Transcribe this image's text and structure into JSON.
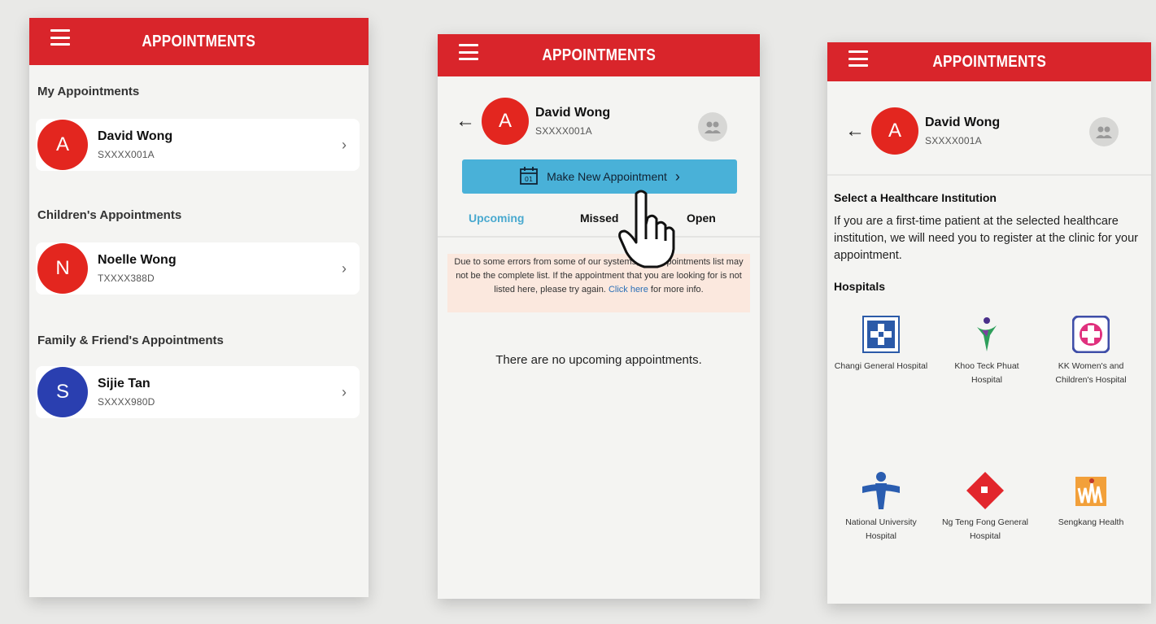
{
  "screen1": {
    "title": "APPOINTMENTS",
    "my_section": "My Appointments",
    "children_section": "Children's Appointments",
    "family_section": "Family & Friend's Appointments",
    "my": {
      "initial": "A",
      "name": "David Wong",
      "id": "SXXXX001A"
    },
    "child": {
      "initial": "N",
      "name": "Noelle Wong",
      "id": "TXXXX388D"
    },
    "family": {
      "initial": "S",
      "name": "Sijie Tan",
      "id": "SXXXX980D"
    }
  },
  "screen2": {
    "title": "APPOINTMENTS",
    "user": {
      "initial": "A",
      "name": "David Wong",
      "id": "SXXXX001A"
    },
    "make_button": "Make New Appointment",
    "tabs": {
      "upcoming": "Upcoming",
      "missed": "Missed",
      "open": "Open"
    },
    "notice_before": "Due to some errors from some of our systems, the Appointments list may not be the complete list. If the appointment that you are looking for is not listed here, please try again.",
    "notice_link": "Click here",
    "notice_after": "for more info.",
    "empty": "There are no upcoming appointments."
  },
  "screen3": {
    "title": "APPOINTMENTS",
    "user": {
      "initial": "A",
      "name": "David Wong",
      "id": "SXXXX001A"
    },
    "institution_title": "Select a Healthcare Institution",
    "institution_desc": "If you are a first-time patient at the selected healthcare institution, we will need you to register at the clinic for your appointment.",
    "hospitals_title": "Hospitals",
    "hospitals": [
      {
        "name": "Changi General Hospital",
        "icon": "changi-general-hospital-logo"
      },
      {
        "name": "Khoo Teck Phuat Hospital",
        "icon": "khoo-teck-phuat-hospital-logo"
      },
      {
        "name": "KK Women's and Children's Hospital",
        "icon": "kk-womens-childrens-hospital-logo"
      },
      {
        "name": "National University Hospital",
        "icon": "national-university-hospital-logo"
      },
      {
        "name": "Ng Teng Fong General Hospital",
        "icon": "ng-teng-fong-hospital-logo"
      },
      {
        "name": "Sengkang Health",
        "icon": "sengkang-health-logo"
      }
    ]
  },
  "colors": {
    "app_bar": "#d9252b",
    "avatar_red": "#e3261f",
    "avatar_blue": "#2a3fb0",
    "primary_button": "#49b1d8",
    "active_tab": "#49a9cf",
    "notice_bg": "#fbe8de"
  }
}
